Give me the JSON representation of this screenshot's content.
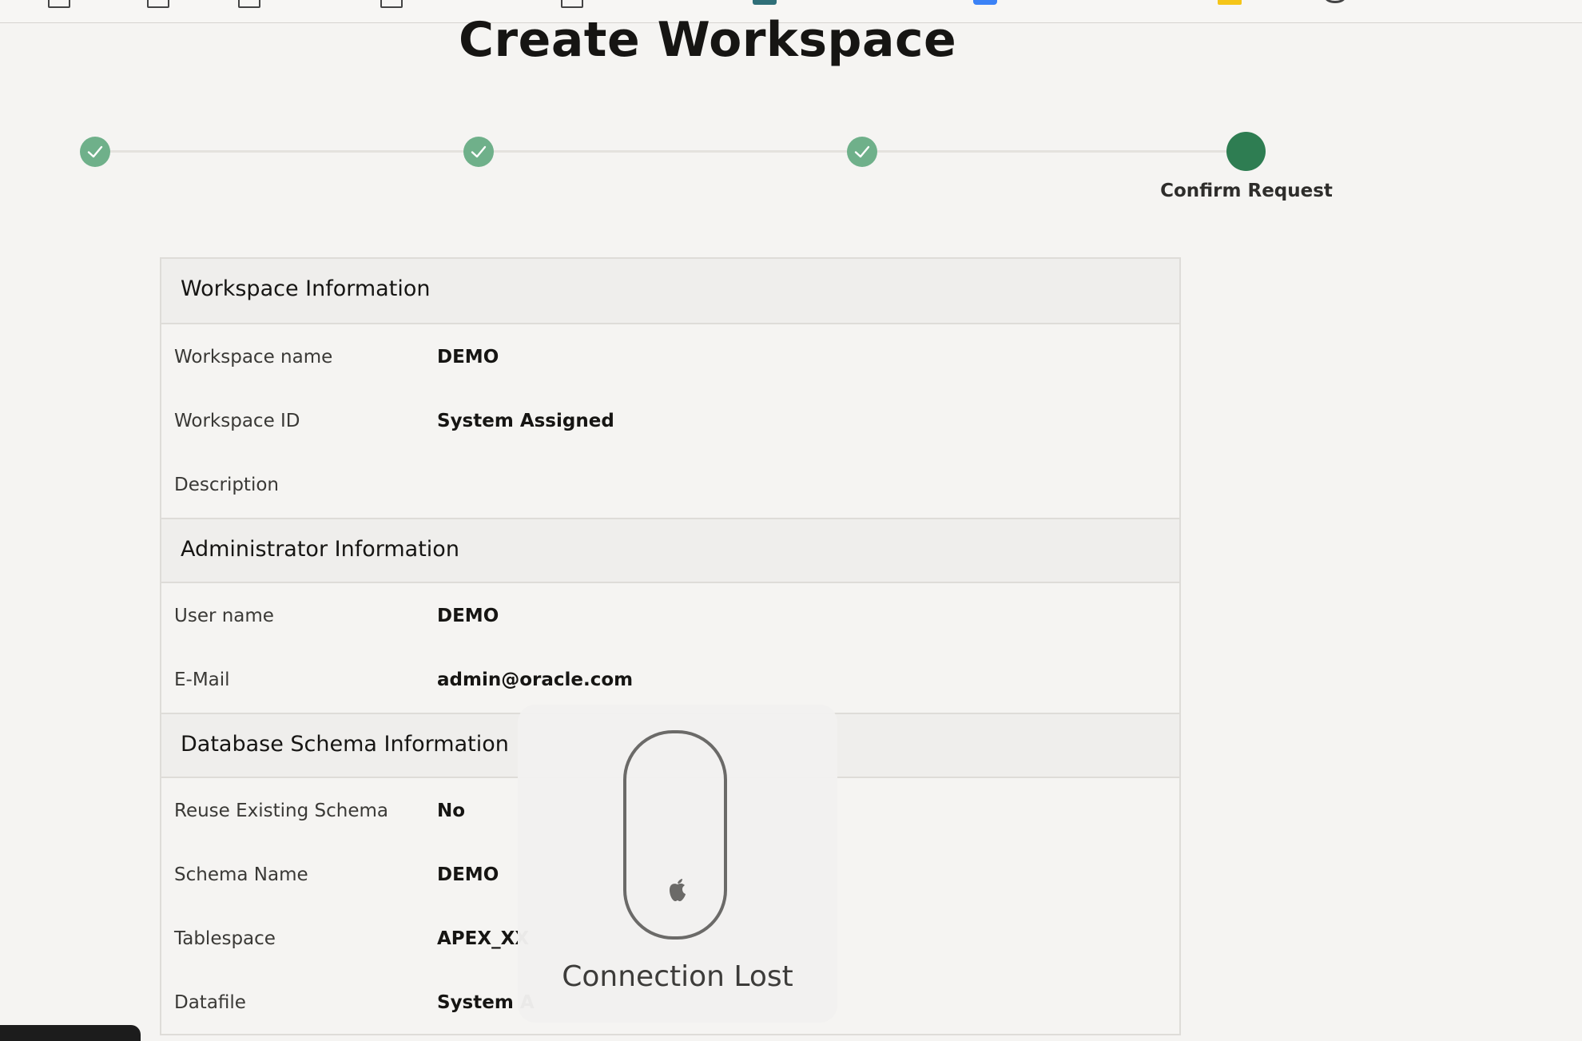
{
  "page": {
    "title": "Create Workspace"
  },
  "wizard": {
    "current_step_label": "Confirm Request"
  },
  "summary": {
    "workspace_section": {
      "title": "Workspace Information",
      "rows": [
        {
          "label": "Workspace name",
          "value": "DEMO"
        },
        {
          "label": "Workspace ID",
          "value": "System Assigned"
        },
        {
          "label": "Description",
          "value": ""
        }
      ]
    },
    "admin_section": {
      "title": "Administrator Information",
      "rows": [
        {
          "label": "User name",
          "value": "DEMO"
        },
        {
          "label": "E-Mail",
          "value": "admin@oracle.com"
        }
      ]
    },
    "schema_section": {
      "title": "Database Schema Information",
      "rows": [
        {
          "label": "Reuse Existing Schema",
          "value": "No"
        },
        {
          "label": "Schema Name",
          "value": "DEMO"
        },
        {
          "label": "Tablespace",
          "value": "APEX_XX"
        },
        {
          "label": "Datafile",
          "value": "System A"
        }
      ]
    }
  },
  "overlay": {
    "message": "Connection Lost",
    "icon": "magic-mouse-icon"
  },
  "colors": {
    "step_completed": "#6fb08a",
    "step_current": "#2e7d52",
    "background": "#f5f4f2",
    "section_header": "#efeeec"
  }
}
